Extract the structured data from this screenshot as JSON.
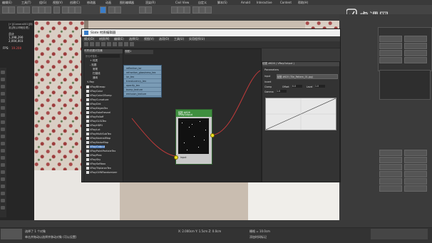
{
  "app": {
    "menu": [
      "编辑(E)",
      "工具(T)",
      "组(G)",
      "视图(V)",
      "创建(C)",
      "修改器",
      "动画",
      "图形编辑器",
      "渲染(R)",
      "Civil View",
      "自定义",
      "脚本(S)",
      "Arnold",
      "Interactive",
      "Content",
      "帮助(H)"
    ],
    "logo_text": "虎课网",
    "viewport_label": "[+][Camera001][标准][默认明暗处理]",
    "stats": {
      "total_label": "总计",
      "polys": "1,398,290",
      "verts": "2,004,003",
      "fps_label": "FPS:",
      "fps": "19.208"
    }
  },
  "dialog": {
    "title": "Slate 材质编辑器",
    "menu": [
      "模式(D)",
      "材质(M)",
      "编辑(E)",
      "选择(S)",
      "视图(V)",
      "选项(O)",
      "工具(U)",
      "实用程序(U)"
    ],
    "browser_header": "材质/贴图浏览器",
    "browser_search": "按名称搜索...",
    "browser_groups": [
      "+ 材质",
      "- 贴图",
      "常规",
      "扫描线",
      "通用",
      "V-Ray"
    ],
    "browser_items": [
      "VRayBitmap",
      "VRayColor",
      "VRayColor2Bump",
      "VRayCurvature",
      "VRayDirt",
      "VRayEdgesTex",
      "VRayFakeFresnel",
      "VRayFalloff",
      "VRayGLSLTex",
      "VRayHDRI",
      "VRayLut",
      "VRayMultiSubTex",
      "VRayNormalMap",
      "VRayNoiseMap",
      "VRayOutput",
      "VRayPointParticleTex",
      "VRayPtex",
      "VRaySky",
      "VRaySoftbox",
      "VRayTriplanarTex",
      "VRayUVWRandomizer"
    ],
    "canvas_tab": "视图1",
    "node_rows": [
      "reflection_ior",
      "refraction_glossiness_tex",
      "ior_tex",
      "translucency_tex",
      "opacity_tex",
      "bump_texture",
      "emission_texture"
    ],
    "bitmap_node": {
      "title": "贴图 #626",
      "subtitle": "VRayOutput",
      "port_label": "Input"
    },
    "params": {
      "header": "贴图 #626 ( VRayOutput )",
      "section": "Parameters",
      "input_label": "Input",
      "input_value": "贴图 #625 (Tile_Pattern_01.jpg)",
      "invert_label": "Invert",
      "clamp_label": "Clamp",
      "offset_label": "Offset",
      "offset_value": "0.0",
      "level_label": "Level",
      "level_value": "1.0",
      "gamma_label": "Gamma",
      "gamma_value": "1.0"
    }
  },
  "status": {
    "line1": "选择了 1 个对象",
    "line2": "单击并拖动以选择并移动对象 (可以设置)",
    "coords": "X: 2.000cm  Y: 1.5cm  Z: 0.0cm",
    "grid": "栅格 = 10.0cm",
    "time": "添加时间标记"
  }
}
